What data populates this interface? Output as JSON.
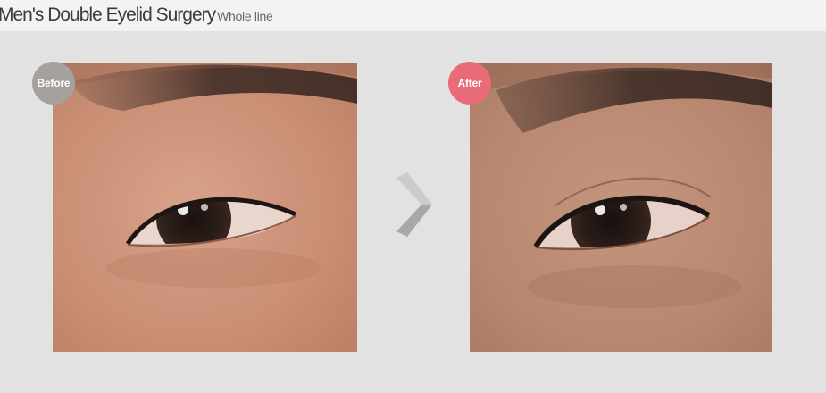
{
  "header": {
    "title": "Men's Double Eyelid Surgery",
    "subtitle": "Whole line"
  },
  "comparison": {
    "before_label": "Before",
    "after_label": "After",
    "before_badge_color": "#a6a09e",
    "after_badge_color": "#e96b78"
  },
  "icons": {
    "arrow": "chevron-right-icon"
  }
}
